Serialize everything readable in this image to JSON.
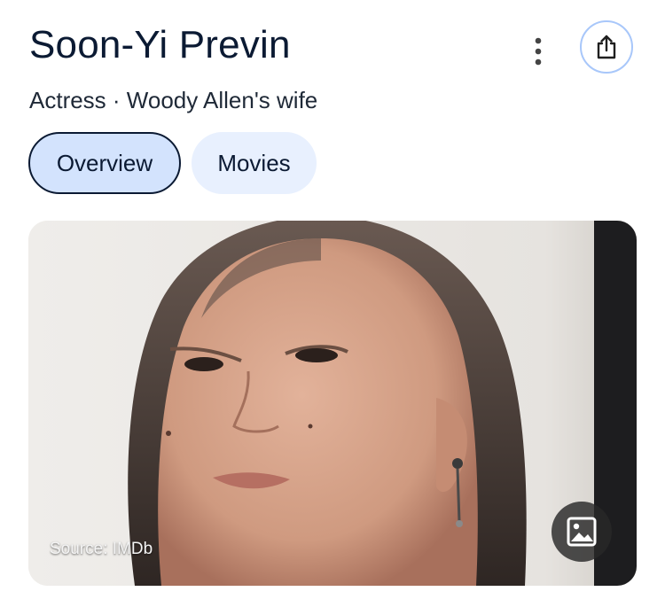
{
  "header": {
    "name": "Soon-Yi Previn",
    "subtitle": "Actress · Woody Allen's wife"
  },
  "icons": {
    "more": "more-vert-icon",
    "share": "share-icon",
    "image": "image-icon"
  },
  "tabs": [
    {
      "label": "Overview",
      "active": true
    },
    {
      "label": "Movies",
      "active": false
    }
  ],
  "photo": {
    "source": "Source: IMDb"
  },
  "colors": {
    "accent_border": "#a8c7fa",
    "tab_active_bg": "#d3e3fd",
    "tab_bg": "#e8f0fe",
    "title": "#0b1a33"
  }
}
